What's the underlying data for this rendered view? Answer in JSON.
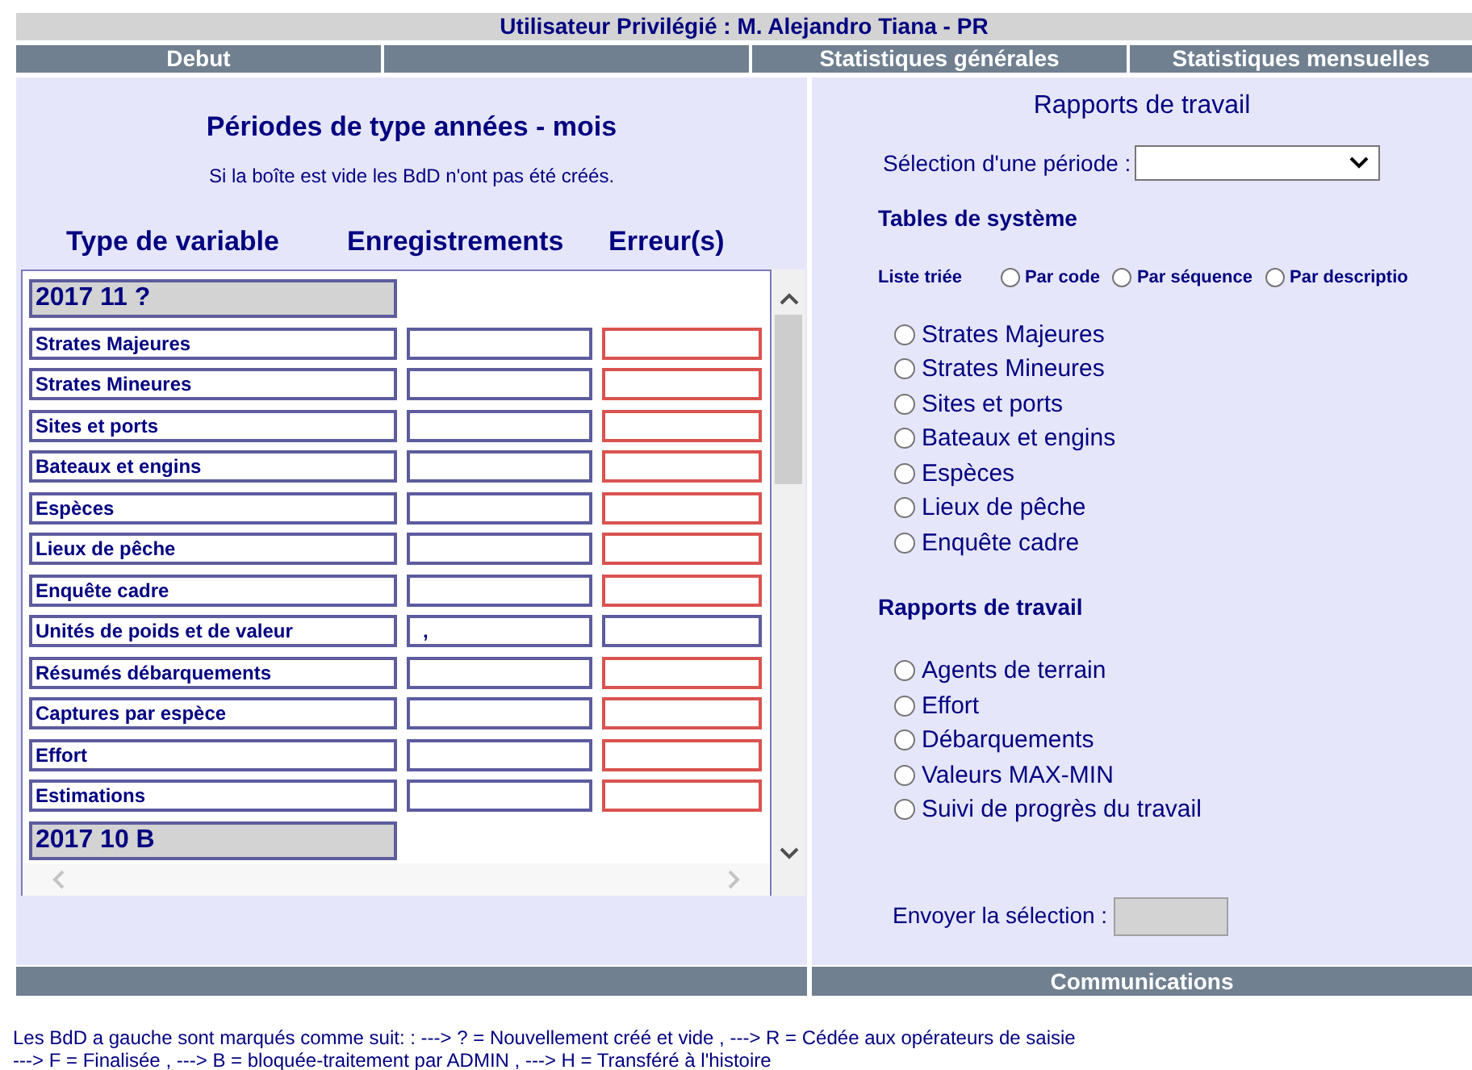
{
  "header": {
    "title": "Utilisateur Privilégié : M. Alejandro Tiana - PR"
  },
  "nav": [
    {
      "label": "Debut"
    },
    {
      "label": "Statistiques générales"
    },
    {
      "label": "Statistiques mensuelles"
    }
  ],
  "left_panel": {
    "title": "Périodes de type années - mois",
    "note": "Si la boîte est vide les BdD n'ont pas été créés.",
    "columns": [
      "Type de variable",
      "Enregistrements",
      "Erreur(s)"
    ],
    "periods": [
      {
        "label": "2017 11 ?",
        "rows": [
          {
            "label": "Strates Majeures",
            "error_flag": true
          },
          {
            "label": "Strates Mineures",
            "error_flag": true
          },
          {
            "label": "Sites et ports",
            "error_flag": true
          },
          {
            "label": "Bateaux et engins",
            "error_flag": true
          },
          {
            "label": "Espèces",
            "error_flag": true
          },
          {
            "label": "Lieux de pêche",
            "error_flag": true
          },
          {
            "label": "Enquête cadre",
            "error_flag": true
          },
          {
            "label": "Unités de poids et de valeur",
            "records": ",",
            "error_flag": false
          },
          {
            "label": "Résumés débarquements",
            "error_flag": true
          },
          {
            "label": "Captures par espèce",
            "error_flag": true
          },
          {
            "label": "Effort",
            "error_flag": true
          },
          {
            "label": "Estimations",
            "error_flag": true
          }
        ]
      },
      {
        "label": "2017 10 B"
      }
    ]
  },
  "right_panel": {
    "title": "Rapports de travail",
    "period_label": "Sélection d'une période :",
    "system_tables": {
      "heading": "Tables de système",
      "sort_label": "Liste triée",
      "sort_options": [
        {
          "label": "Par code",
          "selected": false
        },
        {
          "label": "Par séquence",
          "selected": false
        },
        {
          "label": "Par descriptio",
          "selected": false
        }
      ],
      "items": [
        {
          "label": "Strates Majeures",
          "selected": false
        },
        {
          "label": "Strates Mineures",
          "selected": false
        },
        {
          "label": "Sites et ports",
          "selected": false
        },
        {
          "label": "Bateaux et engins",
          "selected": false
        },
        {
          "label": "Espèces",
          "selected": false
        },
        {
          "label": "Lieux de pêche",
          "selected": false
        },
        {
          "label": "Enquête cadre",
          "selected": false
        }
      ]
    },
    "work_reports": {
      "heading": "Rapports de travail",
      "items": [
        {
          "label": "Agents de terrain",
          "selected": false
        },
        {
          "label": "Effort",
          "selected": false
        },
        {
          "label": "Débarquements",
          "selected": false
        },
        {
          "label": "Valeurs MAX-MIN",
          "selected": false
        },
        {
          "label": "Suivi de progrès du travail",
          "selected": false
        }
      ]
    },
    "send_label": "Envoyer la sélection :"
  },
  "bottom_bar": {
    "title": "Communications"
  },
  "footer": [
    "Les BdD a gauche sont marqués comme suit: : ---> ? = Nouvellement créé et vide , ---> R = Cédée aux opérateurs de saisie",
    "---> F = Finalisée , ---> B = bloquée-traitement par ADMIN , ---> H = Transféré à l'histoire"
  ]
}
